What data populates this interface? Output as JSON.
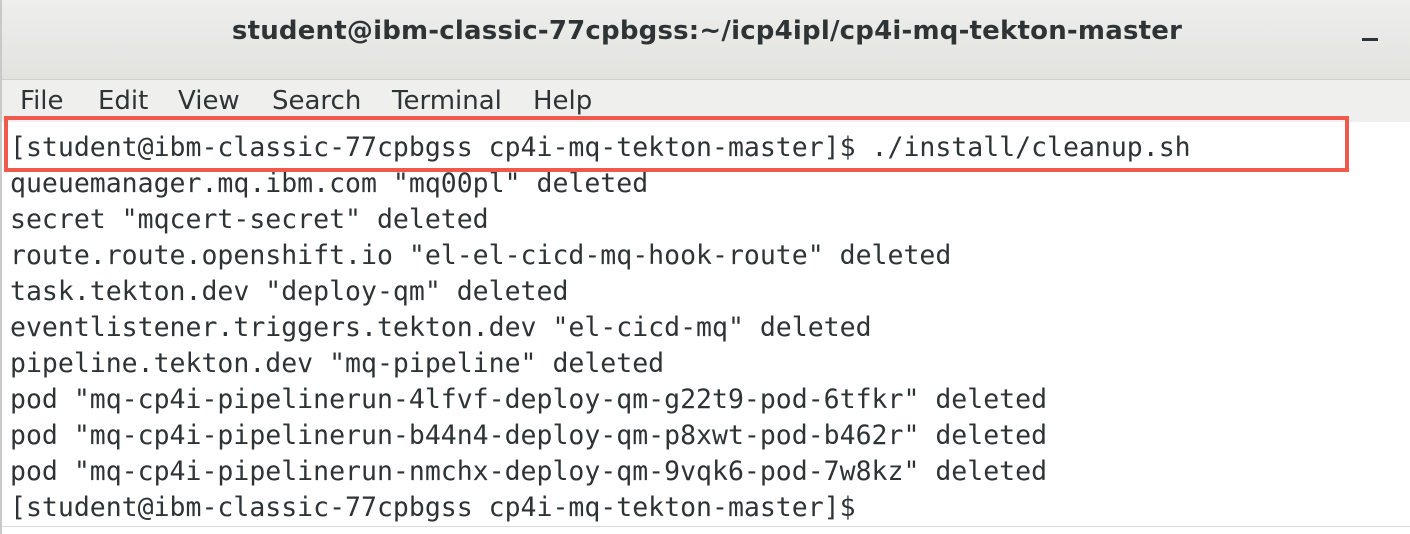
{
  "window": {
    "title": "student@ibm-classic-77cpbgss:~/icp4ipl/cp4i-mq-tekton-master"
  },
  "menu": {
    "items": [
      "File",
      "Edit",
      "View",
      "Search",
      "Terminal",
      "Help"
    ]
  },
  "terminal": {
    "lines": [
      "[student@ibm-classic-77cpbgss cp4i-mq-tekton-master]$ ./install/cleanup.sh",
      "queuemanager.mq.ibm.com \"mq00pl\" deleted",
      "secret \"mqcert-secret\" deleted",
      "route.route.openshift.io \"el-el-cicd-mq-hook-route\" deleted",
      "task.tekton.dev \"deploy-qm\" deleted",
      "eventlistener.triggers.tekton.dev \"el-cicd-mq\" deleted",
      "pipeline.tekton.dev \"mq-pipeline\" deleted",
      "pod \"mq-cp4i-pipelinerun-4lfvf-deploy-qm-g22t9-pod-6tfkr\" deleted",
      "pod \"mq-cp4i-pipelinerun-b44n4-deploy-qm-p8xwt-pod-b462r\" deleted",
      "pod \"mq-cp4i-pipelinerun-nmchx-deploy-qm-9vqk6-pod-7w8kz\" deleted",
      "[student@ibm-classic-77cpbgss cp4i-mq-tekton-master]$"
    ],
    "highlight_color": "#ef5a4c"
  }
}
